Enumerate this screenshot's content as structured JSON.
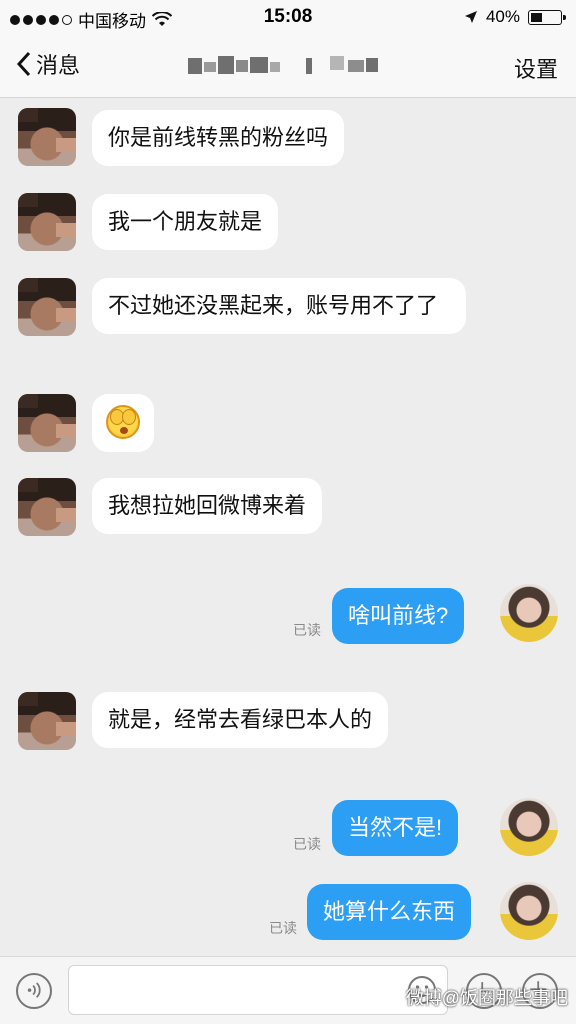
{
  "status_bar": {
    "carrier": "中国移动",
    "time": "15:08",
    "battery": "40%",
    "battery_level": 0.4
  },
  "nav": {
    "back_label": "消息",
    "settings_label": "设置"
  },
  "messages": [
    {
      "side": "in",
      "text": "你是前线转黑的粉丝吗"
    },
    {
      "side": "in",
      "text": "我一个朋友就是"
    },
    {
      "side": "in",
      "text": "不过她还没黑起来，账号用不了了"
    },
    {
      "side": "in",
      "emoji": "covering-face-emoji-icon"
    },
    {
      "side": "in",
      "text": "我想拉她回微博来着"
    },
    {
      "side": "out",
      "text": "啥叫前线?",
      "status": "已读"
    },
    {
      "side": "in",
      "text": "就是，经常去看绿巴本人的"
    },
    {
      "side": "out",
      "text": "当然不是!",
      "status": "已读"
    },
    {
      "side": "out",
      "text": "她算什么东西",
      "status": "已读"
    }
  ],
  "input": {
    "placeholder": ""
  },
  "watermark": "微博@饭圈那些事吧"
}
